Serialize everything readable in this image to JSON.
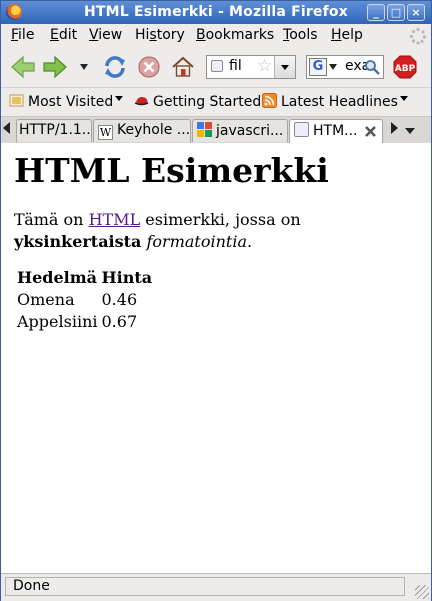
{
  "window": {
    "title": "HTML Esimerkki - Mozilla Firefox",
    "controls": {
      "minimize": "_",
      "maximize": "□",
      "close": "×"
    }
  },
  "menu": {
    "items": [
      {
        "label": "File",
        "accel": "F",
        "rest": "ile"
      },
      {
        "label": "Edit",
        "accel": "E",
        "rest": "dit"
      },
      {
        "label": "View",
        "accel": "V",
        "rest": "iew"
      },
      {
        "label": "History",
        "accel": "s",
        "pre": "Hi",
        "rest": "tory"
      },
      {
        "label": "Bookmarks",
        "accel": "B",
        "rest": "ookmarks"
      },
      {
        "label": "Tools",
        "accel": "T",
        "rest": "ools"
      },
      {
        "label": "Help",
        "accel": "H",
        "rest": "elp"
      }
    ]
  },
  "nav": {
    "url_text": "fil",
    "search_text": "exa",
    "abp_label": "ABP"
  },
  "bookmarks": {
    "most_visited": "Most Visited",
    "getting_started": "Getting Started",
    "latest_headlines": "Latest Headlines"
  },
  "tabs": [
    {
      "label": "HTTP/1.1..."
    },
    {
      "label": "Keyhole ..."
    },
    {
      "label": "javascri..."
    },
    {
      "label": "HTM..."
    }
  ],
  "page": {
    "heading": "HTML Esimerkki",
    "para_start": "Tämä on ",
    "link_text": "HTML",
    "para_mid": " esimerkki, jossa on",
    "bold_text": "yksinkertaista",
    "italic_text": "formatointia",
    "para_end": ".",
    "table": {
      "headers": [
        "Hedelmä",
        "Hinta"
      ],
      "rows": [
        [
          "Omena",
          "0.46"
        ],
        [
          "Appelsiini",
          "0.67"
        ]
      ]
    }
  },
  "status": {
    "text": "Done"
  },
  "colors": {
    "titlebar": "#2f64b8",
    "link_visited": "#551a8b",
    "chrome": "#edeceb"
  }
}
